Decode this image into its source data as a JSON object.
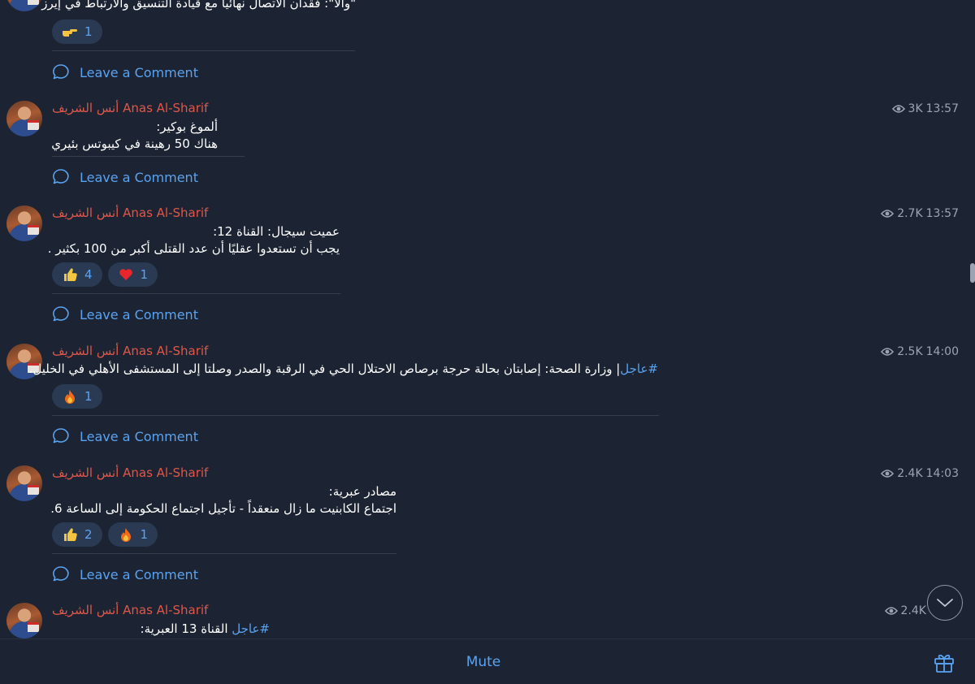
{
  "channel": {
    "bottom_bar": {
      "mute_label": "Mute",
      "gift_icon": "gift-icon"
    },
    "scroll_down_icon": "chevron-down-icon"
  },
  "comment_label": "Leave a Comment",
  "posts": [
    {
      "body": [
        "\"والا\": فقدان الاتصال نهائيا مع قيادة التنسيق والارتباط في إيرز"
      ],
      "reactions": [
        {
          "emoji": "pointing-hand",
          "count": "1"
        }
      ]
    },
    {
      "author": "أنس الشريف Anas Al-Sharif",
      "views": "3K",
      "time": "13:57",
      "body": [
        "ألموغ بوكير:",
        "هناك 50 رهينة في كيبوتس بئيري"
      ],
      "reactions": []
    },
    {
      "author": "أنس الشريف Anas Al-Sharif",
      "views": "2.7K",
      "time": "13:57",
      "body": [
        "عميت سيجال: القناة 12:",
        "يجب أن تستعدوا عقليًا أن عدد القتلى أكبر من 100 بكثير ."
      ],
      "reactions": [
        {
          "emoji": "thumbs-up",
          "count": "4"
        },
        {
          "emoji": "red-heart",
          "count": "1"
        }
      ]
    },
    {
      "author": "أنس الشريف Anas Al-Sharif",
      "views": "2.5K",
      "time": "14:00",
      "hashtag": "#عاجل",
      "body": [
        "| وزارة الصحة: إصابتان بحالة حرجة برصاص الاحتلال الحي في الرقبة والصدر وصلتا إلى المستشفى الأهلي في الخليل."
      ],
      "reactions": [
        {
          "emoji": "fire",
          "count": "1"
        }
      ]
    },
    {
      "author": "أنس الشريف Anas Al-Sharif",
      "views": "2.4K",
      "time": "14:03",
      "body": [
        "مصادر عبرية:",
        "اجتماع الكابنيت ما زال منعقداً - تأجيل اجتماع الحكومة إلى الساعة 6."
      ],
      "reactions": [
        {
          "emoji": "thumbs-up",
          "count": "2"
        },
        {
          "emoji": "fire",
          "count": "1"
        }
      ]
    },
    {
      "author": "أنس الشريف Anas Al-Sharif",
      "views": "2.4K",
      "time": "",
      "hashtag": "#عاجل",
      "body": [
        " القناة 13 العبرية:"
      ],
      "reactions": []
    }
  ],
  "colors": {
    "background": "#1c2433",
    "author": "#e0574a",
    "link": "#5aa3f0",
    "reaction_bg": "#2a3a53",
    "meta": "#9aa4b2"
  }
}
